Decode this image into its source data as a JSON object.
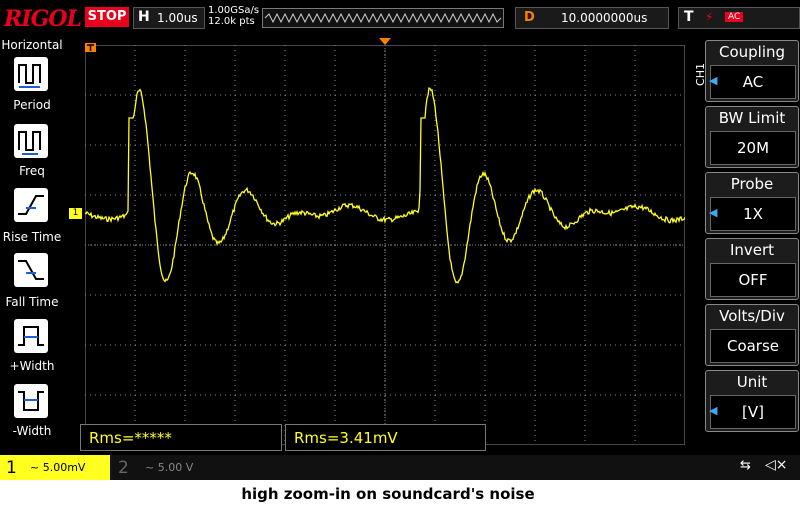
{
  "app": {
    "brand": "RIGOL",
    "run_state": "STOP"
  },
  "timebase": {
    "label": "H",
    "value": "1.00us"
  },
  "acquisition": {
    "sample_rate": "1.00GSa/s",
    "points": "12.0k pts"
  },
  "delay": {
    "label": "D",
    "value": "10.0000000us"
  },
  "trigger": {
    "label": "T",
    "edge_symbol": "⚡",
    "coupling": "AC"
  },
  "left_panel": {
    "title": "Horizontal",
    "items": [
      {
        "label": "Period"
      },
      {
        "label": "Freq"
      },
      {
        "label": "Rise Time"
      },
      {
        "label": "Fall Time"
      },
      {
        "label": "+Width"
      },
      {
        "label": "-Width"
      }
    ]
  },
  "right_panel": {
    "channel": "CH1",
    "items": [
      {
        "title": "Coupling",
        "value": "AC"
      },
      {
        "title": "BW Limit",
        "value": "20M"
      },
      {
        "title": "Probe",
        "value": "1X"
      },
      {
        "title": "Invert",
        "value": "OFF"
      },
      {
        "title": "Volts/Div",
        "value": "Coarse"
      },
      {
        "title": "Unit",
        "value": "[V]"
      }
    ]
  },
  "markers": {
    "ch1_ground": "1"
  },
  "measurements": [
    {
      "text": "Rms=*****"
    },
    {
      "text": "Rms=3.41mV"
    }
  ],
  "bottom_bar": {
    "ch1": {
      "number": "1",
      "scale": "~ 5.00mV"
    },
    "ch2": {
      "number": "2",
      "scale": "~ 5.00 V"
    }
  },
  "colors": {
    "ch1": "#ffff20",
    "brand": "#e8001c",
    "accent": "#3fa9f5",
    "trigger_marker": "#ff8000"
  },
  "caption": "high zoom-in on soundcard's  noise"
}
